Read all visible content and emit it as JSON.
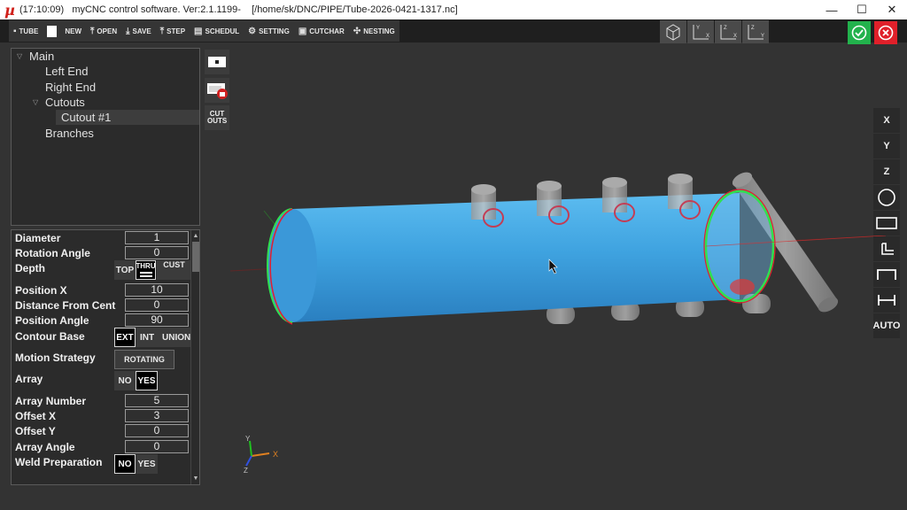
{
  "titlebar": {
    "logo": "µ",
    "title": "(17:10:09)   myCNC control software. Ver:2.1.1199-    [/home/sk/DNC/PIPE/Tube-2026-0421-1317.nc]",
    "min": "—",
    "max": "☐",
    "close": "✕"
  },
  "toolbar": {
    "tube": "TUBE",
    "new": "NEW",
    "open": "OPEN",
    "save": "SAVE",
    "step": "STEP",
    "schedul": "SCHEDUL",
    "setting": "SETTING",
    "cutchar": "CUTCHAR",
    "nesting": "NESTING"
  },
  "viewbuttons": {
    "iso": "",
    "xy": "Y X",
    "xz": "Z X",
    "yz": "Z Y"
  },
  "tree": {
    "main": "Main",
    "left_end": "Left End",
    "right_end": "Right End",
    "cutouts": "Cutouts",
    "cutout1": "Cutout #1",
    "branches": "Branches"
  },
  "props": {
    "diameter_label": "Diameter",
    "diameter": "1",
    "rotation_angle_label": "Rotation Angle",
    "rotation_angle": "0",
    "depth_label": "Depth",
    "depth_top": "TOP",
    "depth_thru": "THRU",
    "depth_cust": "CUST",
    "position_x_label": "Position X",
    "position_x": "10",
    "distance_label": "Distance From Cent",
    "distance": "0",
    "position_angle_label": "Position Angle",
    "position_angle": "90",
    "contour_base_label": "Contour Base",
    "contour_ext": "EXT",
    "contour_int": "INT",
    "contour_union": "UNION",
    "motion_strategy_label": "Motion Strategy",
    "motion_strategy": "ROTATING",
    "array_label": "Array",
    "array_no": "NO",
    "array_yes": "YES",
    "array_number_label": "Array Number",
    "array_number": "5",
    "offset_x_label": "Offset X",
    "offset_x": "3",
    "offset_y_label": "Offset Y",
    "offset_y": "0",
    "array_angle_label": "Array Angle",
    "array_angle": "0",
    "weld_prep_label": "Weld Preparation",
    "weld_no": "NO",
    "weld_yes": "YES"
  },
  "sidebuttons": {
    "cutouts": "CUT OUTS"
  },
  "rightbar": {
    "x": "X",
    "y": "Y",
    "z": "Z",
    "auto": "AUTO"
  },
  "axis": {
    "x": "X",
    "y": "Y",
    "z": "Z"
  },
  "colors": {
    "tube": "#3fa3e0",
    "ok": "#22b24c",
    "cancel": "#e0202a",
    "cut_path": "#e02030",
    "end_green": "#30e050"
  }
}
